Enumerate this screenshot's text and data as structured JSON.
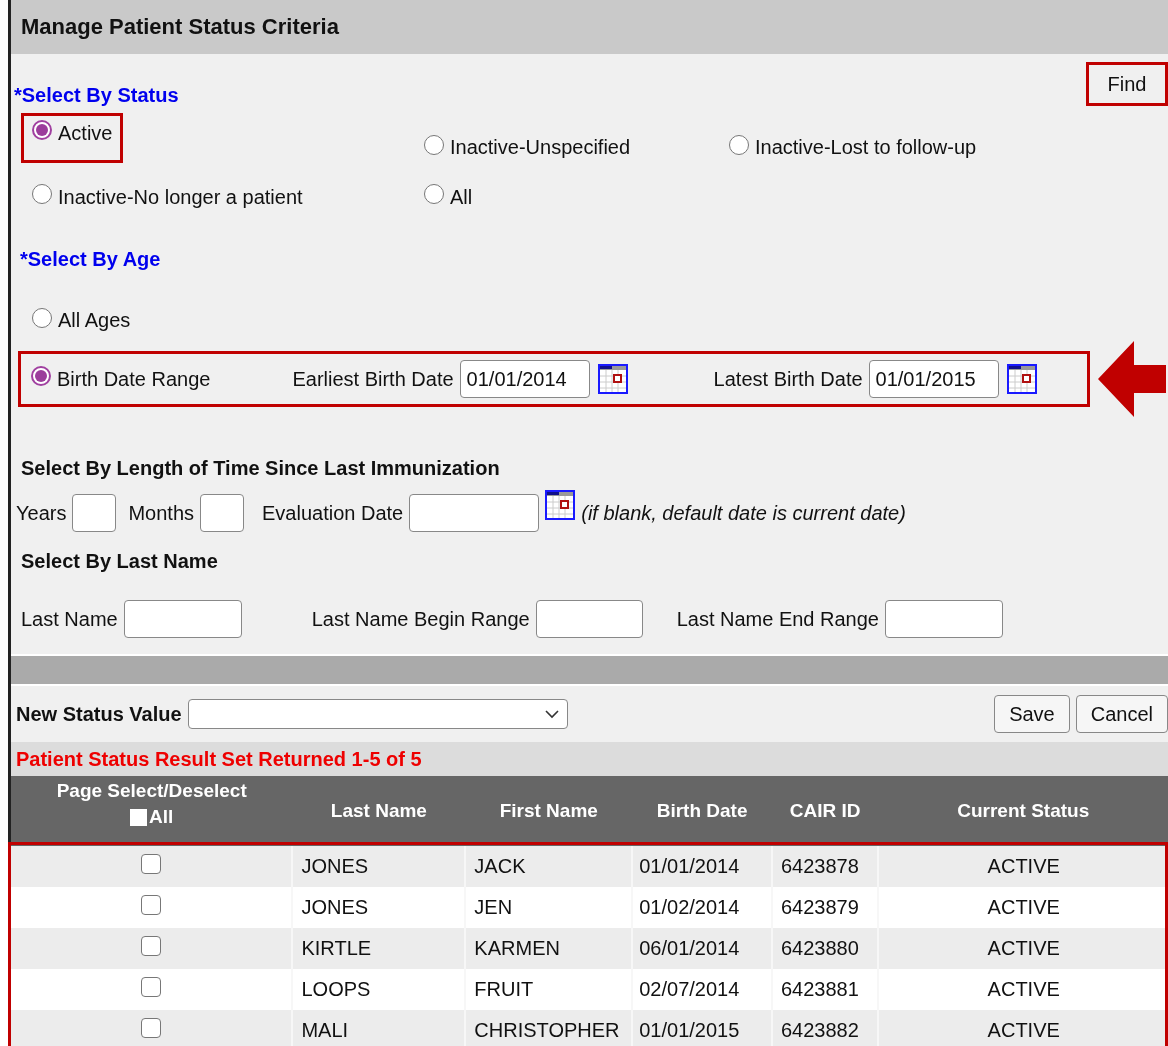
{
  "title": "Manage Patient Status Criteria",
  "find_button": {
    "label": "Find",
    "highlighted": true
  },
  "status_section": {
    "heading": "*Select By Status",
    "options": [
      {
        "label": "Active",
        "selected": true,
        "highlighted": true
      },
      {
        "label": "Inactive-Unspecified",
        "selected": false,
        "highlighted": false
      },
      {
        "label": "Inactive-Lost to follow-up",
        "selected": false,
        "highlighted": false
      },
      {
        "label": "Inactive-No longer a patient",
        "selected": false,
        "highlighted": false
      },
      {
        "label": "All",
        "selected": false,
        "highlighted": false
      }
    ]
  },
  "age_section": {
    "heading": "*Select By Age",
    "options": [
      {
        "kind": "plain",
        "label": "All Ages",
        "selected": false,
        "highlighted": false
      },
      {
        "kind": "range",
        "label": "Birth Date Range",
        "selected": true,
        "highlighted": true,
        "pointer_arrow": true,
        "earliest": {
          "label": "Earliest Birth Date",
          "value": "01/01/2014"
        },
        "latest": {
          "label": "Latest Birth Date",
          "value": "01/01/2015"
        }
      }
    ]
  },
  "immunization_section": {
    "heading": "Select By Length of Time Since Last Immunization",
    "years_label": "Years",
    "months_label": "Months",
    "evaluation_label": "Evaluation Date",
    "hint": "(if blank, default date is current date)"
  },
  "last_name_section": {
    "heading": "Select By Last Name",
    "fields": [
      {
        "label": "Last Name"
      },
      {
        "label": "Last Name Begin Range"
      },
      {
        "label": "Last Name End Range"
      }
    ]
  },
  "new_status": {
    "label": "New Status Value",
    "buttons": [
      "Save",
      "Cancel"
    ]
  },
  "result_summary": "Patient Status Result Set Returned 1-5 of 5",
  "table": {
    "select_header": "Page Select/Deselect",
    "select_all": {
      "label": "All",
      "checked": false
    },
    "highlighted": true,
    "columns": [
      "Last Name",
      "First Name",
      "Birth Date",
      "CAIR ID",
      "Current Status"
    ],
    "rows": [
      {
        "checked": false,
        "cells": [
          "JONES",
          "JACK",
          "01/01/2014",
          "6423878",
          "ACTIVE"
        ]
      },
      {
        "checked": false,
        "cells": [
          "JONES",
          "JEN",
          "01/02/2014",
          "6423879",
          "ACTIVE"
        ]
      },
      {
        "checked": false,
        "cells": [
          "KIRTLE",
          "KARMEN",
          "06/01/2014",
          "6423880",
          "ACTIVE"
        ]
      },
      {
        "checked": false,
        "cells": [
          "LOOPS",
          "FRUIT",
          "02/07/2014",
          "6423881",
          "ACTIVE"
        ]
      },
      {
        "checked": false,
        "cells": [
          "MALI",
          "CHRISTOPHER",
          "01/01/2015",
          "6423882",
          "ACTIVE"
        ]
      }
    ]
  }
}
